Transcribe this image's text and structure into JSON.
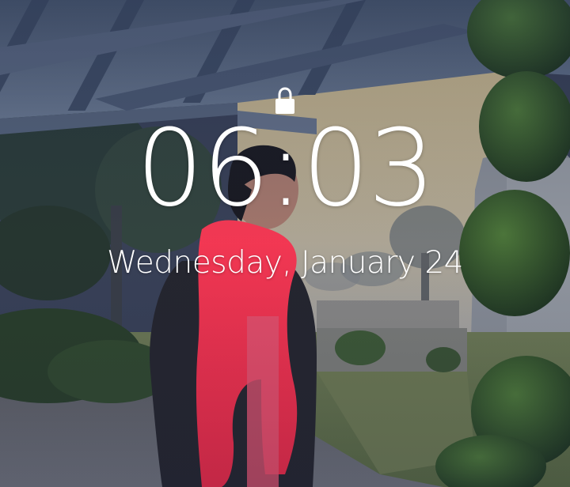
{
  "lockscreen": {
    "lock_icon": "lock-icon",
    "time": "06:03",
    "date": "Wednesday, January 24",
    "text_color": "#ffffff"
  },
  "wallpaper": {
    "description_icon": "photo-wallpaper"
  }
}
